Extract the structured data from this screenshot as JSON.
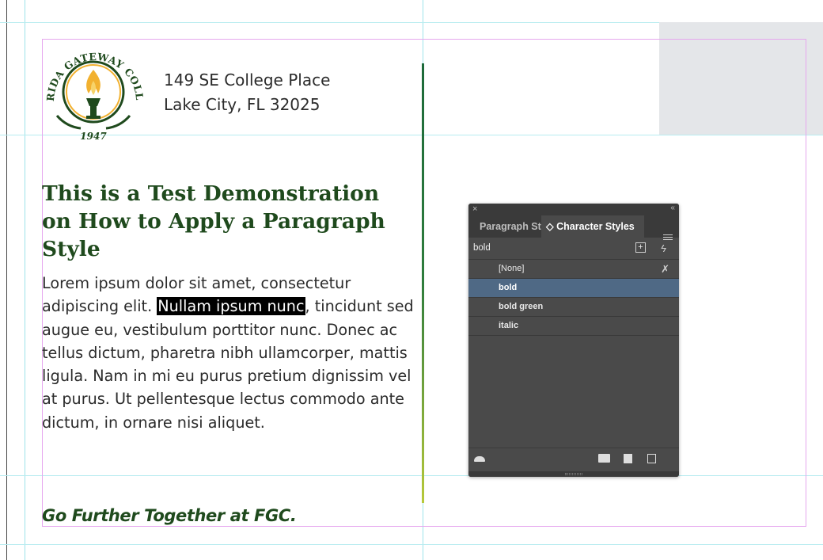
{
  "document": {
    "logo": {
      "arc_text": "FLORIDA GATEWAY COLLEGE",
      "year": "1947"
    },
    "address": {
      "line1": "149 SE College Place",
      "line2": "Lake City, FL 32025"
    },
    "title": "This is a Test Demonstration on How to Apply a Paragraph Style",
    "body": {
      "before": "Lorem ipsum dolor sit amet, consectetur adipiscing elit. ",
      "highlighted": "Nullam ipsum nunc",
      "after": ", tincidunt sed augue eu, vestibulum porttitor nunc. Donec ac tellus dictum, pharetra nibh ullamcorper, mattis ligula. Nam in mi eu purus pretium dignissim vel at purus. Ut pellentesque lectus commodo ante dictum, in ornare nisi aliquet."
    },
    "tagline": "Go Further Together at FGC."
  },
  "panel": {
    "close_glyph": "×",
    "collapse_glyph": "‹‹",
    "tabs": [
      {
        "label": "Paragraph St",
        "active": false
      },
      {
        "label": "◇ Character Styles",
        "active": true
      }
    ],
    "current_style": "bold",
    "new_group_glyph": "+",
    "lightning_glyph": "ϟ",
    "clear_glyph": "✗",
    "styles": [
      {
        "label": "[None]",
        "selected": false
      },
      {
        "label": "bold",
        "selected": true
      },
      {
        "label": "bold green",
        "selected": false
      },
      {
        "label": "italic",
        "selected": false
      }
    ],
    "bottom_icons": [
      "cloud-library-icon",
      "folder-icon",
      "new-style-icon",
      "trash-icon"
    ]
  },
  "colors": {
    "title_green": "#1f4a1d",
    "panel_bg": "#4a4a4a",
    "selected_row": "#4f6985",
    "logo_gold": "#f2b130"
  }
}
